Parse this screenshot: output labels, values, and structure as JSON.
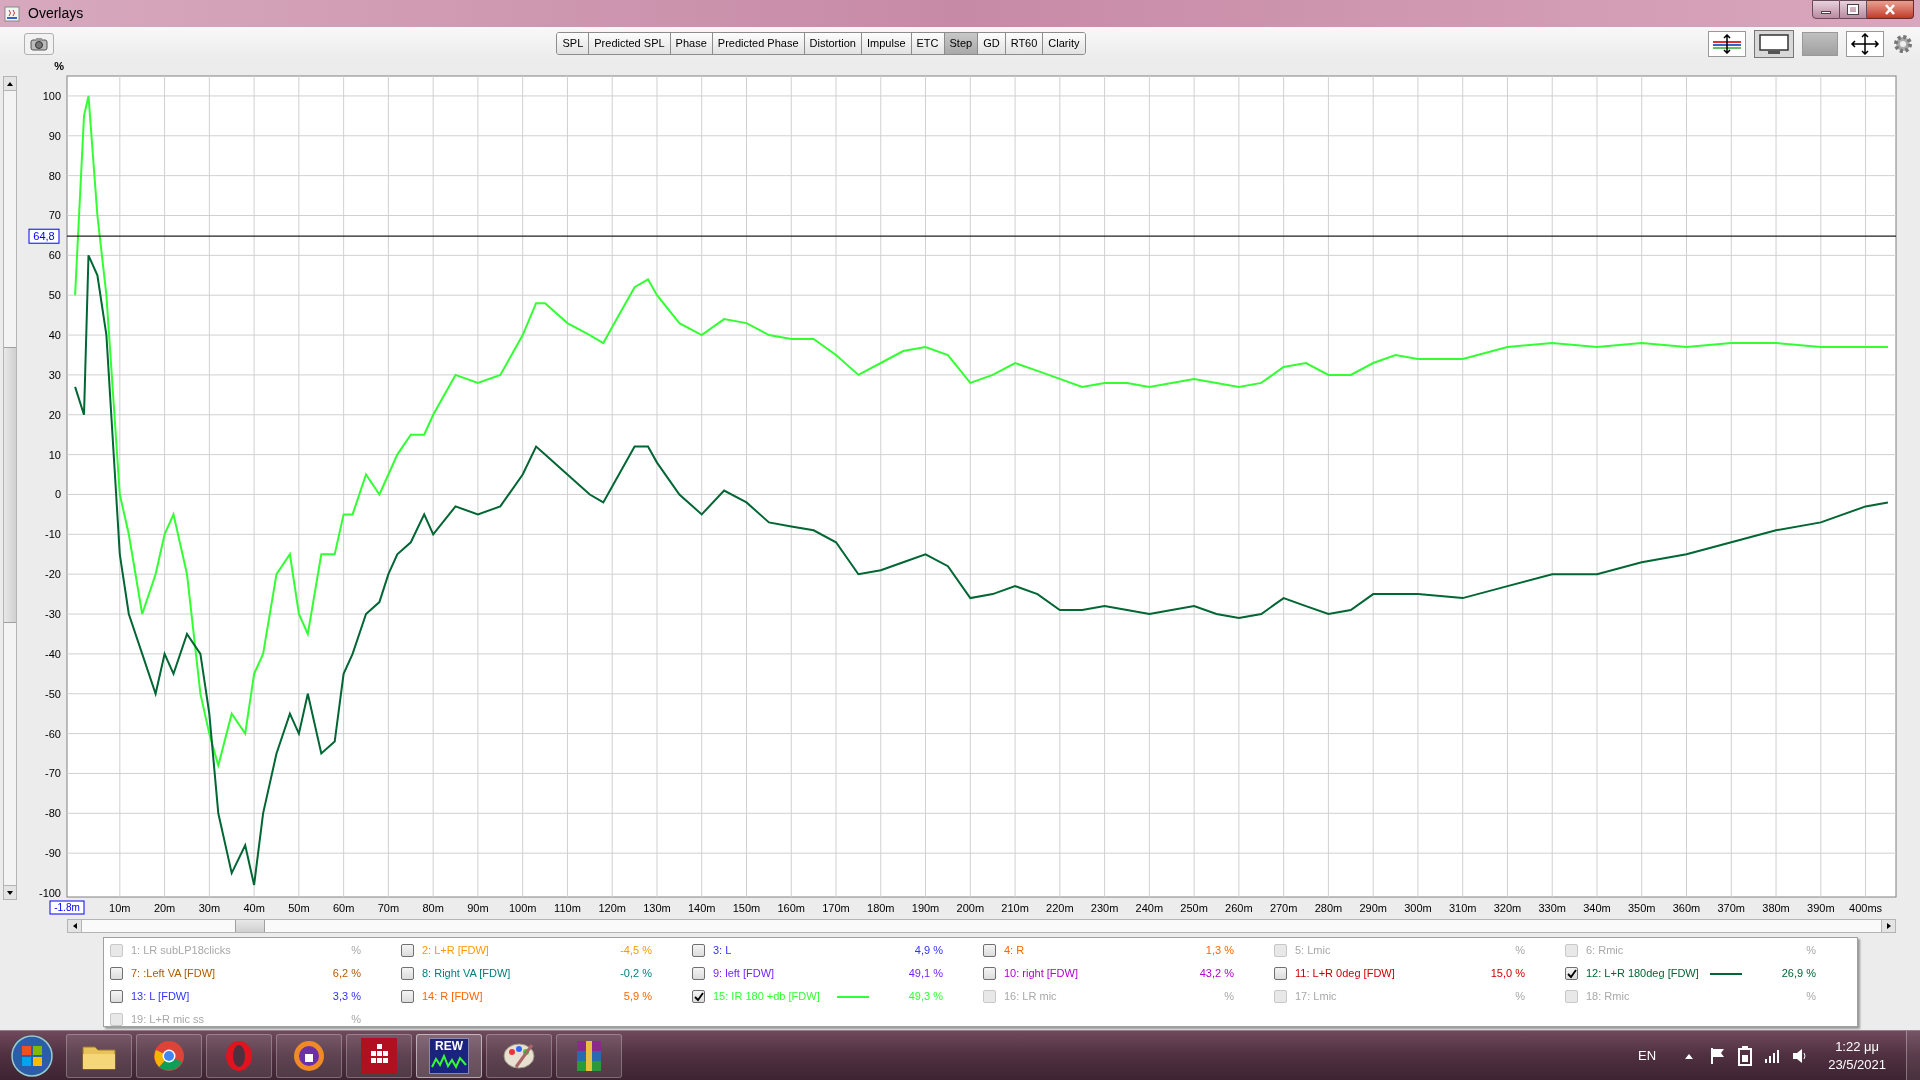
{
  "window": {
    "title": "Overlays"
  },
  "tabs": [
    {
      "label": "SPL",
      "selected": false
    },
    {
      "label": "Predicted SPL",
      "selected": false
    },
    {
      "label": "Phase",
      "selected": false
    },
    {
      "label": "Predicted Phase",
      "selected": false
    },
    {
      "label": "Distortion",
      "selected": false
    },
    {
      "label": "Impulse",
      "selected": false
    },
    {
      "label": "ETC",
      "selected": false
    },
    {
      "label": "Step",
      "selected": true
    },
    {
      "label": "GD",
      "selected": false
    },
    {
      "label": "RT60",
      "selected": false
    },
    {
      "label": "Clarity",
      "selected": false
    }
  ],
  "chart": {
    "chart_data": {
      "type": "line",
      "ylabel": "%",
      "xlim": [
        -1.8,
        406.8
      ],
      "ylim": [
        -101,
        105
      ],
      "x": [
        0,
        2,
        3,
        5,
        7,
        10,
        12,
        15,
        18,
        20,
        22,
        25,
        28,
        30,
        32,
        35,
        38,
        40,
        42,
        45,
        48,
        50,
        52,
        55,
        58,
        60,
        62,
        65,
        68,
        70,
        72,
        75,
        78,
        80,
        85,
        90,
        95,
        100,
        103,
        105,
        110,
        115,
        118,
        120,
        125,
        128,
        130,
        135,
        140,
        145,
        150,
        155,
        160,
        165,
        170,
        175,
        180,
        185,
        190,
        195,
        200,
        205,
        210,
        215,
        220,
        225,
        230,
        235,
        240,
        245,
        250,
        255,
        260,
        265,
        270,
        275,
        280,
        285,
        290,
        295,
        300,
        310,
        320,
        330,
        340,
        350,
        360,
        370,
        380,
        390,
        400,
        405
      ],
      "series": [
        {
          "color": "#33ff33",
          "values": [
            50,
            95,
            100,
            70,
            50,
            0,
            -10,
            -30,
            -20,
            -10,
            -5,
            -20,
            -50,
            -60,
            -68,
            -55,
            -60,
            -45,
            -40,
            -20,
            -15,
            -30,
            -35,
            -15,
            -15,
            -5,
            -5,
            5,
            0,
            5,
            10,
            15,
            15,
            20,
            30,
            28,
            30,
            40,
            48,
            48,
            43,
            40,
            38,
            42,
            52,
            54,
            50,
            43,
            40,
            44,
            43,
            40,
            39,
            39,
            35,
            30,
            33,
            36,
            37,
            35,
            28,
            30,
            33,
            31,
            29,
            27,
            28,
            28,
            27,
            28,
            29,
            28,
            27,
            28,
            32,
            33,
            30,
            30,
            33,
            35,
            34,
            34,
            37,
            38,
            37,
            38,
            37,
            38,
            38,
            37,
            37,
            37
          ]
        },
        {
          "color": "#006633",
          "values": [
            27,
            20,
            60,
            55,
            40,
            -15,
            -30,
            -40,
            -50,
            -40,
            -45,
            -35,
            -40,
            -55,
            -80,
            -95,
            -88,
            -98,
            -80,
            -65,
            -55,
            -60,
            -50,
            -65,
            -62,
            -45,
            -40,
            -30,
            -27,
            -20,
            -15,
            -12,
            -5,
            -10,
            -3,
            -5,
            -3,
            5,
            12,
            10,
            5,
            0,
            -2,
            2,
            12,
            12,
            8,
            0,
            -5,
            1,
            -2,
            -7,
            -8,
            -9,
            -12,
            -20,
            -19,
            -17,
            -15,
            -18,
            -26,
            -25,
            -23,
            -25,
            -29,
            -29,
            -28,
            -29,
            -30,
            -29,
            -28,
            -30,
            -31,
            -30,
            -26,
            -28,
            -30,
            -29,
            -25,
            -25,
            -25,
            -26,
            -23,
            -20,
            -20,
            -17,
            -15,
            -12,
            -9,
            -7,
            -3,
            -2
          ]
        }
      ],
      "xticks": [
        {
          "value": -1.8,
          "label": "-1.8m"
        },
        {
          "value": 10,
          "label": "10m"
        },
        {
          "value": 20,
          "label": "20m"
        },
        {
          "value": 30,
          "label": "30m"
        },
        {
          "value": 40,
          "label": "40m"
        },
        {
          "value": 50,
          "label": "50m"
        },
        {
          "value": 60,
          "label": "60m"
        },
        {
          "value": 70,
          "label": "70m"
        },
        {
          "value": 80,
          "label": "80m"
        },
        {
          "value": 90,
          "label": "90m"
        },
        {
          "value": 100,
          "label": "100m"
        },
        {
          "value": 110,
          "label": "110m"
        },
        {
          "value": 120,
          "label": "120m"
        },
        {
          "value": 130,
          "label": "130m"
        },
        {
          "value": 140,
          "label": "140m"
        },
        {
          "value": 150,
          "label": "150m"
        },
        {
          "value": 160,
          "label": "160m"
        },
        {
          "value": 170,
          "label": "170m"
        },
        {
          "value": 180,
          "label": "180m"
        },
        {
          "value": 190,
          "label": "190m"
        },
        {
          "value": 200,
          "label": "200m"
        },
        {
          "value": 210,
          "label": "210m"
        },
        {
          "value": 220,
          "label": "220m"
        },
        {
          "value": 230,
          "label": "230m"
        },
        {
          "value": 240,
          "label": "240m"
        },
        {
          "value": 250,
          "label": "250m"
        },
        {
          "value": 260,
          "label": "260m"
        },
        {
          "value": 270,
          "label": "270m"
        },
        {
          "value": 280,
          "label": "280m"
        },
        {
          "value": 290,
          "label": "290m"
        },
        {
          "value": 300,
          "label": "300m"
        },
        {
          "value": 310,
          "label": "310m"
        },
        {
          "value": 320,
          "label": "320m"
        },
        {
          "value": 330,
          "label": "330m"
        },
        {
          "value": 340,
          "label": "340m"
        },
        {
          "value": 350,
          "label": "350m"
        },
        {
          "value": 360,
          "label": "360m"
        },
        {
          "value": 370,
          "label": "370m"
        },
        {
          "value": 380,
          "label": "380m"
        },
        {
          "value": 390,
          "label": "390m"
        },
        {
          "value": 400,
          "label": "400ms"
        }
      ],
      "yticks": [
        100,
        90,
        80,
        70,
        60,
        50,
        40,
        30,
        20,
        10,
        0,
        -10,
        -20,
        -30,
        -40,
        -50,
        -60,
        -70,
        -80,
        -90,
        -100
      ],
      "grid": true,
      "ref_lines": [
        {
          "axis": "y",
          "value": 64.8,
          "label": "64,8"
        }
      ]
    }
  },
  "legend": [
    {
      "label": "1: LR subLP18clicks",
      "value": "%",
      "checked": false,
      "disabled": true
    },
    {
      "label": "2: L+R [FDW]",
      "value": "-4,5 %",
      "checked": false,
      "disabled": false,
      "color": "#ff9900"
    },
    {
      "label": "3: L",
      "value": "4,9 %",
      "checked": false,
      "disabled": false,
      "color": "#3333ff"
    },
    {
      "label": "4: R",
      "value": "1,3 %",
      "checked": false,
      "disabled": false,
      "color": "#ff6600"
    },
    {
      "label": "5: Lmic",
      "value": "%",
      "checked": false,
      "disabled": true
    },
    {
      "label": "6: Rmic",
      "value": "%",
      "checked": false,
      "disabled": true
    },
    {
      "label": "7: :Left VA [FDW]",
      "value": "6,2 %",
      "checked": false,
      "disabled": false,
      "color": "#b35900"
    },
    {
      "label": "8: Right VA [FDW]",
      "value": "-0,2 %",
      "checked": false,
      "disabled": false,
      "color": "#008080"
    },
    {
      "label": "9: left [FDW]",
      "value": "49,1 %",
      "checked": false,
      "disabled": false,
      "color": "#7a1fff"
    },
    {
      "label": "10: right [FDW]",
      "value": "43,2 %",
      "checked": false,
      "disabled": false,
      "color": "#b000d0"
    },
    {
      "label": "11: L+R 0deg [FDW]",
      "value": "15,0 %",
      "checked": false,
      "disabled": false,
      "color": "#cc0000"
    },
    {
      "label": "12: L+R 180deg [FDW]",
      "value": "26,9 %",
      "checked": true,
      "disabled": false,
      "color": "#006633"
    },
    {
      "label": "13: L [FDW]",
      "value": "3,3 %",
      "checked": false,
      "disabled": false,
      "color": "#3333ff"
    },
    {
      "label": "14: R [FDW]",
      "value": "5,9 %",
      "checked": false,
      "disabled": false,
      "color": "#ff6600"
    },
    {
      "label": "15: IR 180 +db [FDW]",
      "value": "49,3 %",
      "checked": true,
      "disabled": false,
      "color": "#33ff33"
    },
    {
      "label": "16: LR mic",
      "value": "%",
      "checked": false,
      "disabled": true
    },
    {
      "label": "17: Lmic",
      "value": "%",
      "checked": false,
      "disabled": true
    },
    {
      "label": "18: Rmic",
      "value": "%",
      "checked": false,
      "disabled": true
    },
    {
      "label": "19: L+R mic ss",
      "value": "%",
      "checked": false,
      "disabled": true
    }
  ],
  "taskbar": {
    "rew_label": "REW",
    "language": "EN",
    "time": "1:22 μμ",
    "date": "23/5/2021"
  }
}
